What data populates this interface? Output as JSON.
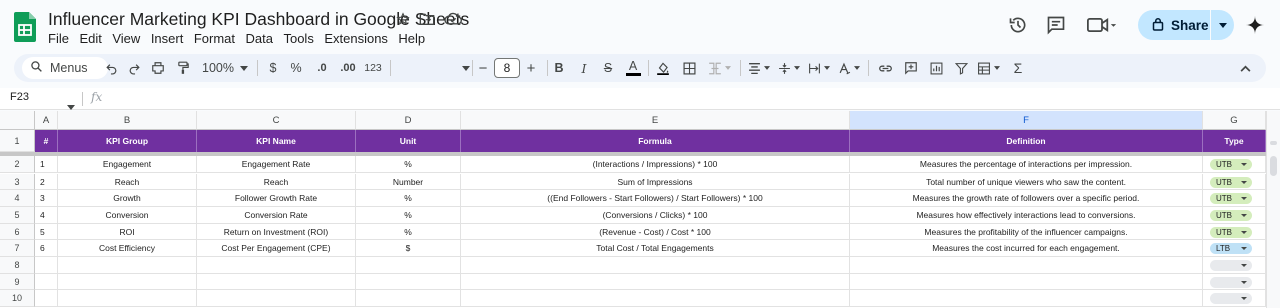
{
  "app": {
    "title": "Influencer Marketing KPI Dashboard in Google Sheets",
    "menus": [
      "File",
      "Edit",
      "View",
      "Insert",
      "Format",
      "Data",
      "Tools",
      "Extensions",
      "Help"
    ],
    "share_label": "Share"
  },
  "toolbar": {
    "search_label": "Menus",
    "zoom": "100%",
    "currency": "$",
    "percent": "%",
    "dec_decrease": ".0",
    "dec_increase": ".00",
    "number_format": "123",
    "font_size": "8",
    "minus": "−",
    "plus": "+",
    "bold": "B",
    "italic": "I",
    "strike": "S",
    "text_color": "A",
    "text_color_value": "#000000",
    "function": "Σ"
  },
  "formula_bar": {
    "name_box": "F23",
    "fx": "fx",
    "value": ""
  },
  "sheet": {
    "columns": [
      "A",
      "B",
      "C",
      "D",
      "E",
      "F",
      "G"
    ],
    "selected_column": "F",
    "header_color": "#7030a0",
    "headers": [
      "#",
      "KPI Group",
      "KPI Name",
      "Unit",
      "Formula",
      "Definition",
      "Type"
    ],
    "row_numbers": [
      "1",
      "2",
      "3",
      "4",
      "5",
      "6",
      "7",
      "8",
      "9",
      "10"
    ],
    "rows": [
      {
        "num": "1",
        "group": "Engagement",
        "name": "Engagement Rate",
        "unit": "%",
        "formula": "(Interactions / Impressions) * 100",
        "definition": "Measures the percentage of interactions per impression.",
        "type": "UTB"
      },
      {
        "num": "2",
        "group": "Reach",
        "name": "Reach",
        "unit": "Number",
        "formula": "Sum of Impressions",
        "definition": "Total number of unique viewers who saw the content.",
        "type": "UTB"
      },
      {
        "num": "3",
        "group": "Growth",
        "name": "Follower Growth Rate",
        "unit": "%",
        "formula": "((End Followers - Start Followers) / Start Followers) * 100",
        "definition": "Measures the growth rate of followers over a specific period.",
        "type": "UTB"
      },
      {
        "num": "4",
        "group": "Conversion",
        "name": "Conversion Rate",
        "unit": "%",
        "formula": "(Conversions / Clicks) * 100",
        "definition": "Measures how effectively interactions lead to conversions.",
        "type": "UTB"
      },
      {
        "num": "5",
        "group": "ROI",
        "name": "Return on Investment (ROI)",
        "unit": "%",
        "formula": "(Revenue - Cost) / Cost * 100",
        "definition": "Measures the profitability of the influencer campaigns.",
        "type": "UTB"
      },
      {
        "num": "6",
        "group": "Cost Efficiency",
        "name": "Cost Per Engagement (CPE)",
        "unit": "$",
        "formula": "Total Cost / Total Engagements",
        "definition": "Measures the cost incurred for each engagement.",
        "type": "LTB"
      }
    ],
    "chip_colors": {
      "UTB": "#d4edbc",
      "LTB": "#bfe1f6",
      "empty": "#e8eaed"
    }
  }
}
